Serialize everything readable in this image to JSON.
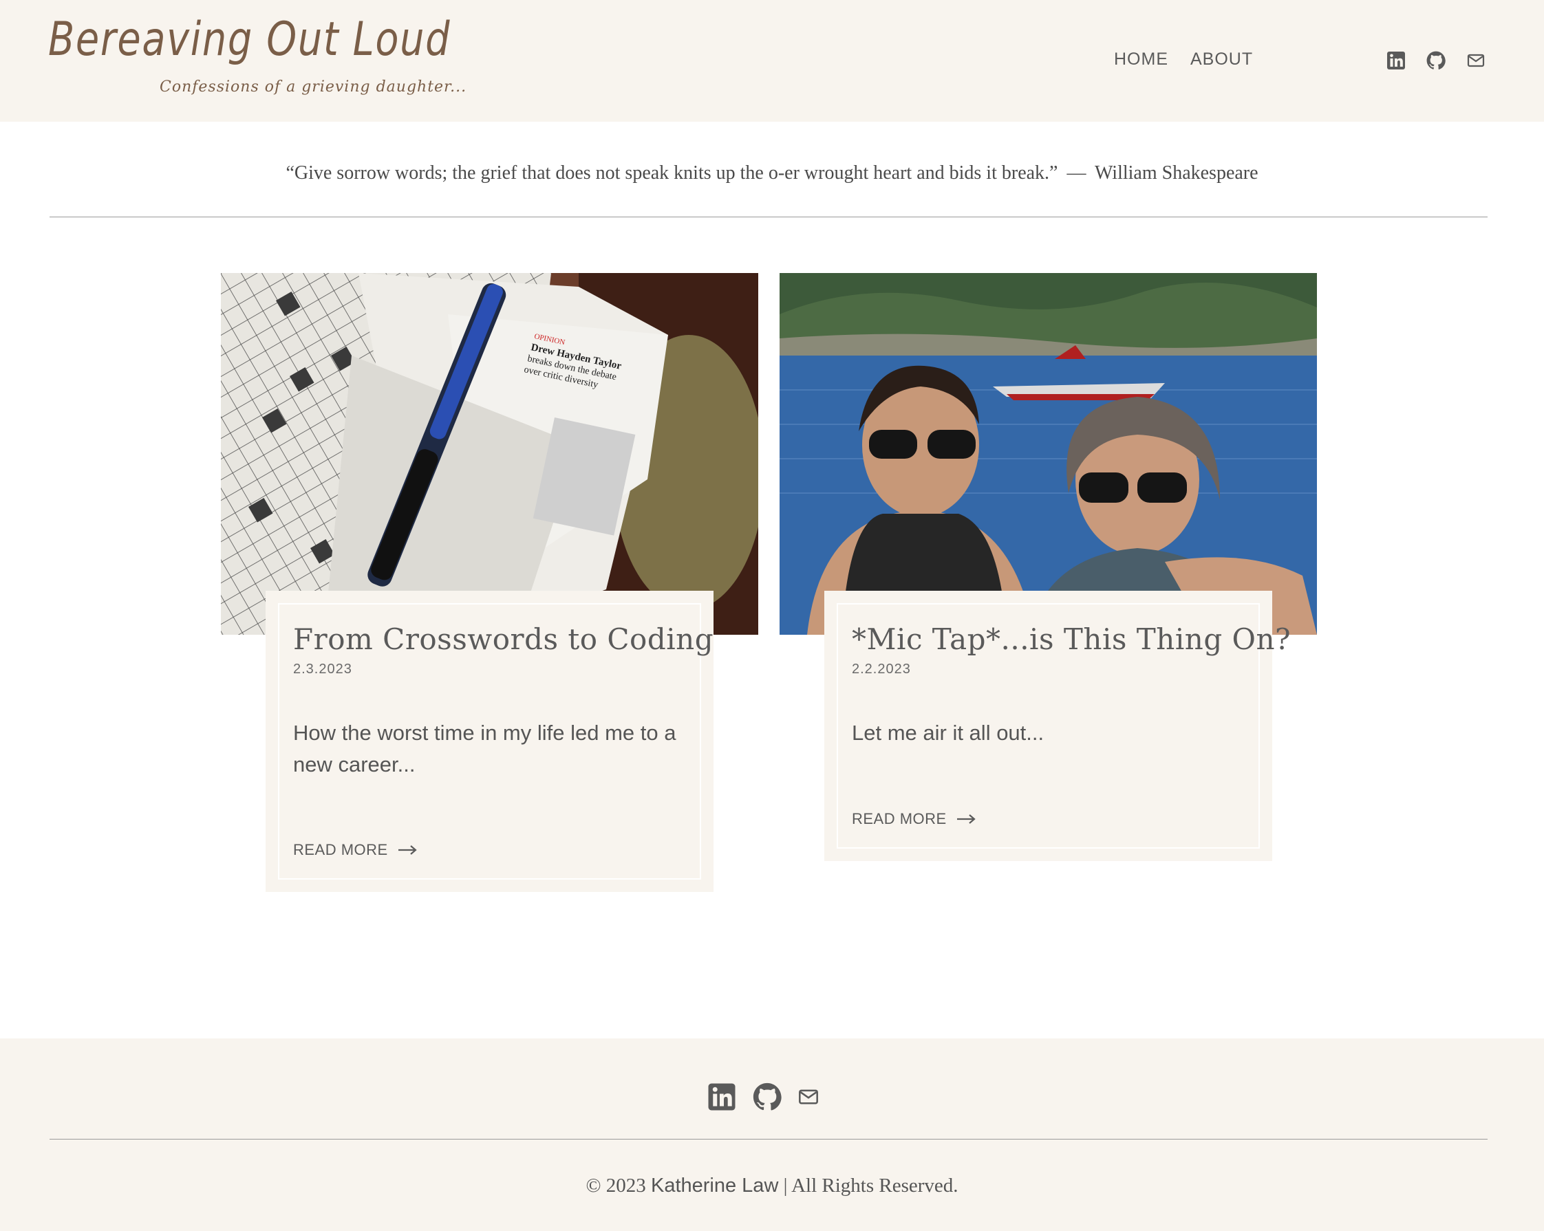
{
  "header": {
    "logo_title": "Bereaving Out Loud",
    "logo_tagline": "Confessions of a grieving daughter...",
    "nav": [
      {
        "label": "HOME"
      },
      {
        "label": "ABOUT"
      }
    ],
    "social_icons": [
      "linkedin-icon",
      "github-icon",
      "mail-icon"
    ]
  },
  "quote": {
    "text": "“Give sorrow words; the grief that does not speak knits up the o-er wrought heart and bids it break.”",
    "dash": "—",
    "author": "William Shakespeare"
  },
  "posts": [
    {
      "title": "From Crosswords to Coding",
      "date": "2.3.2023",
      "excerpt": "How the worst time in my life led me to a new career...",
      "read_more": "READ MORE",
      "image_icon": "crossword-newspaper-pen-image",
      "image_text": [
        "OPINION",
        "Drew Hayden Taylor",
        "breaks down the debate",
        "over critic diversity"
      ]
    },
    {
      "title": "*Mic Tap*...is This Thing On?",
      "date": "2.2.2023",
      "excerpt": "Let me air it all out...",
      "read_more": "READ MORE",
      "image_icon": "lake-photo-two-women-image"
    }
  ],
  "footer": {
    "social_icons": [
      "linkedin-icon",
      "github-icon",
      "mail-icon"
    ],
    "copyright_prefix": "© 2023",
    "copyright_name": "Katherine Law",
    "copyright_suffix": "| All Rights Reserved."
  },
  "colors": {
    "header_bg": "#f8f4ee",
    "logo_brown": "#7a5e48",
    "text_gray": "#5a5a5a"
  }
}
